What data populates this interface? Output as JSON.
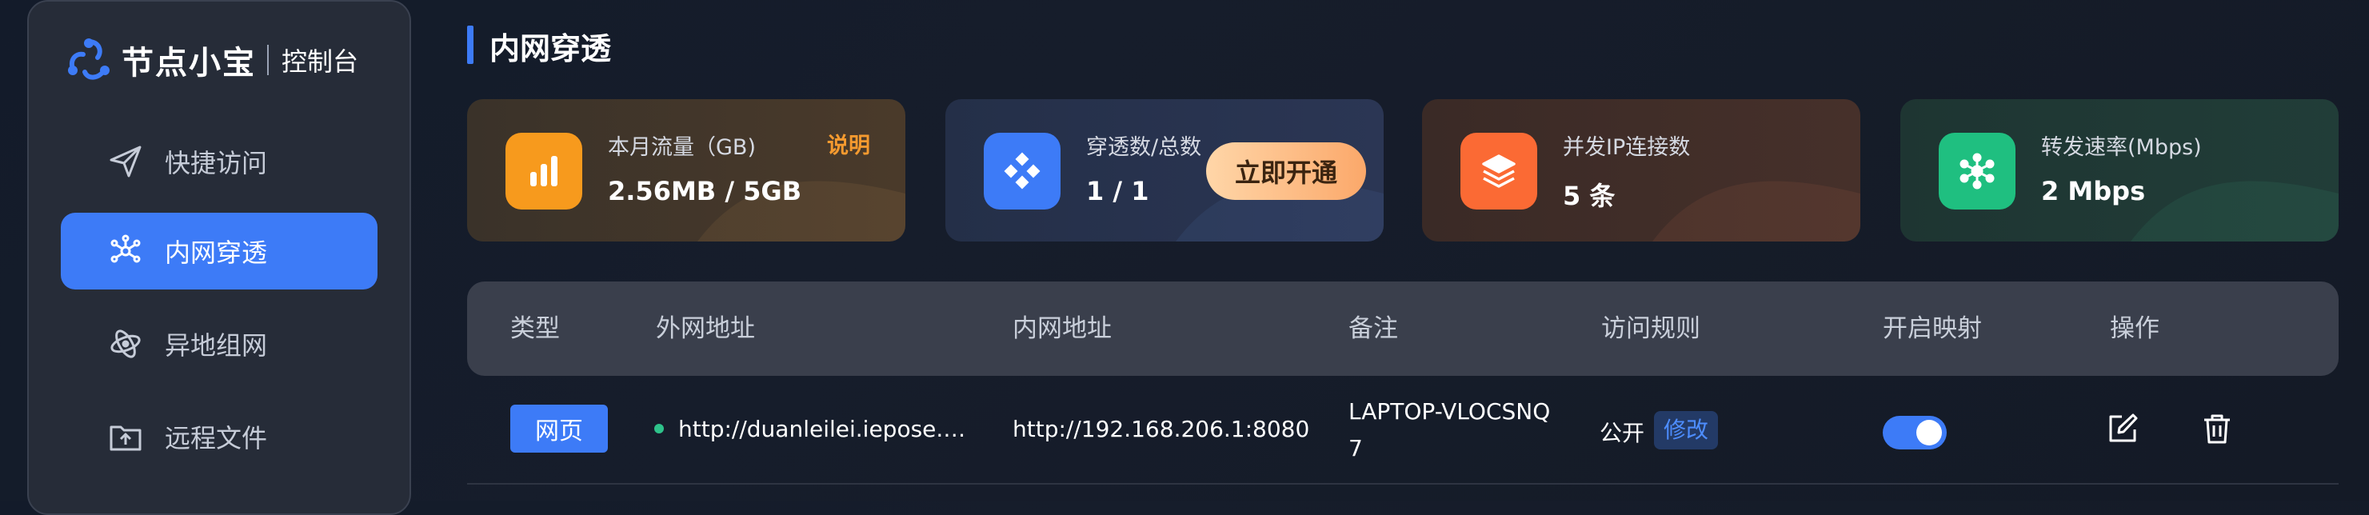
{
  "brand": {
    "name": "节点小宝",
    "subtitle": "控制台"
  },
  "sidebar": {
    "items": [
      {
        "label": "快捷访问",
        "icon": "send-icon",
        "active": false
      },
      {
        "label": "内网穿透",
        "icon": "network-nodes-icon",
        "active": true
      },
      {
        "label": "异地组网",
        "icon": "atom-icon",
        "active": false
      },
      {
        "label": "远程文件",
        "icon": "folder-upload-icon",
        "active": false
      }
    ]
  },
  "page": {
    "title": "内网穿透"
  },
  "stats": [
    {
      "label": "本月流量（GB)",
      "value": "2.56MB / 5GB",
      "extra": "说明",
      "icon": "bar-chart-icon",
      "color": "#f79a1d"
    },
    {
      "label": "穿透数/总数",
      "value": "1 / 1",
      "button": "立即开通",
      "icon": "diamond-grid-icon",
      "color": "#3d7bf7"
    },
    {
      "label": "并发IP连接数",
      "value": "5 条",
      "icon": "layers-icon",
      "color": "#fb6a34"
    },
    {
      "label": "转发速率(Mbps)",
      "value": "2 Mbps",
      "icon": "hub-icon",
      "color": "#1fbf80"
    }
  ],
  "table": {
    "columns": [
      "类型",
      "外网地址",
      "内网地址",
      "备注",
      "访问规则",
      "开启映射",
      "操作"
    ],
    "rows": [
      {
        "type": "网页",
        "external": "http://duanleilei.ieposе.…",
        "internal": "http://192.168.206.1:8080",
        "note_line1": "LAPTOP-VLOCSNQ",
        "note_line2": "7",
        "rule": "公开",
        "rule_action": "修改",
        "mapping_enabled": true
      }
    ]
  },
  "colors": {
    "accent": "#3d7bf7",
    "status_online": "#2ec28a"
  }
}
